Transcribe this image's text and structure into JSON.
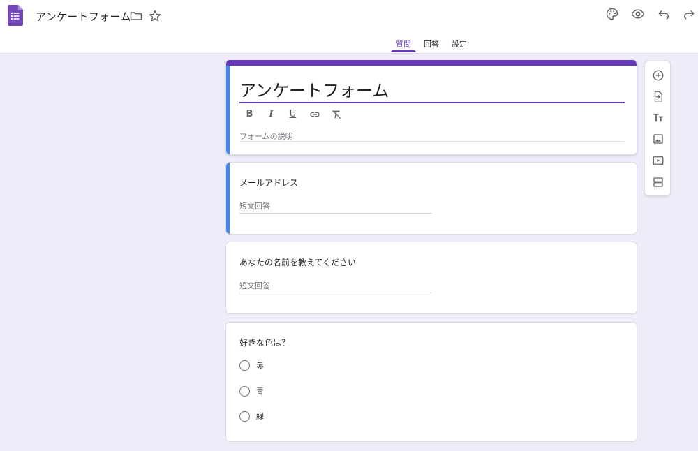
{
  "header": {
    "title": "アンケートフォーム",
    "icons": [
      "forms-logo-icon",
      "folder-icon",
      "star-icon",
      "palette-icon",
      "preview-eye-icon",
      "undo-icon",
      "redo-icon"
    ]
  },
  "tabs": [
    {
      "label": "質問",
      "active": true
    },
    {
      "label": "回答",
      "active": false
    },
    {
      "label": "設定",
      "active": false
    }
  ],
  "form": {
    "title": "アンケートフォーム",
    "description_placeholder": "フォームの説明",
    "format_buttons": {
      "bold": "B",
      "italic": "I",
      "underline": "U"
    }
  },
  "questions": [
    {
      "title": "メールアドレス",
      "type": "short",
      "answer_placeholder": "短文回答"
    },
    {
      "title": "あなたの名前を教えてください",
      "type": "short",
      "answer_placeholder": "短文回答"
    },
    {
      "title": "好きな色は？",
      "type": "radio",
      "options": [
        "赤",
        "青",
        "緑"
      ]
    }
  ],
  "side_toolbar": [
    "add-question-icon",
    "import-question-icon",
    "add-title-icon",
    "add-image-icon",
    "add-video-icon",
    "add-section-icon"
  ],
  "colors": {
    "accent": "#673ab7",
    "focus": "#4285f4",
    "background": "#efebf8"
  }
}
